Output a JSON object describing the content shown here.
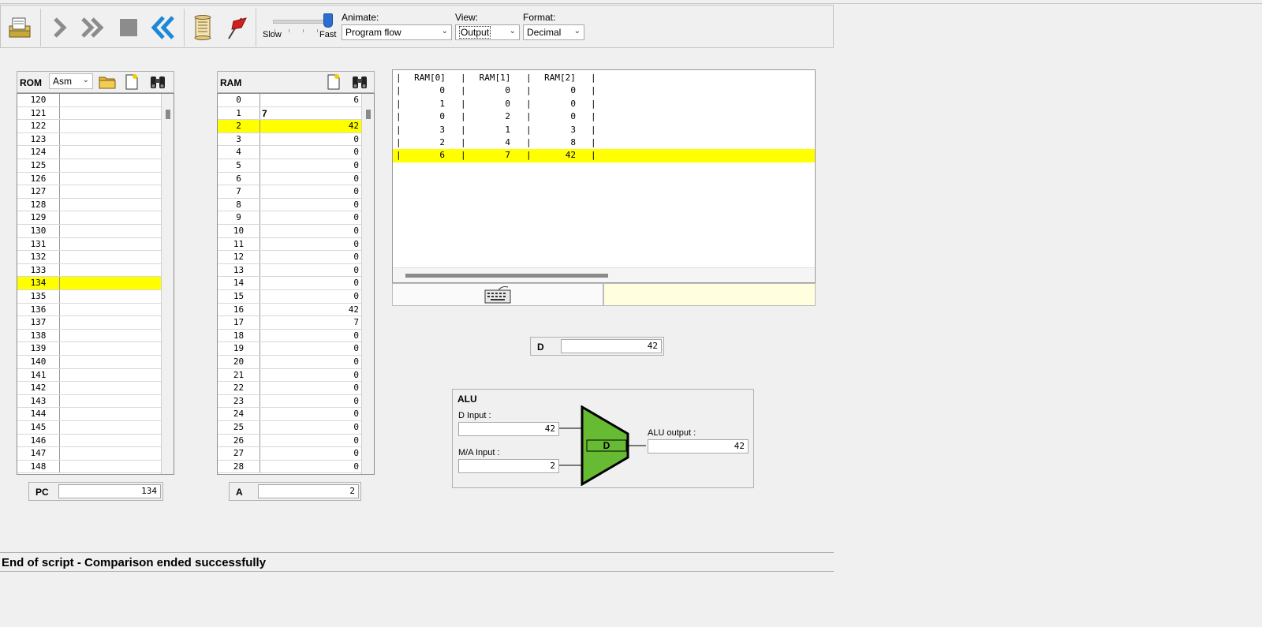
{
  "toolbar": {
    "speed": {
      "slow_label": "Slow",
      "fast_label": "Fast",
      "value": 1.0
    },
    "animate": {
      "label": "Animate:",
      "selected": "Program flow"
    },
    "view": {
      "label": "View:",
      "selected": "Output"
    },
    "format": {
      "label": "Format:",
      "selected": "Decimal"
    },
    "buttons": [
      "load-program-icon",
      "single-step-icon",
      "run-icon",
      "stop-icon",
      "reset-icon",
      "script-icon",
      "breakpoints-icon"
    ]
  },
  "rom": {
    "title": "ROM",
    "mode": "Asm",
    "highlight_row": 14,
    "rows": [
      {
        "idx": "120",
        "val": ""
      },
      {
        "idx": "121",
        "val": ""
      },
      {
        "idx": "122",
        "val": ""
      },
      {
        "idx": "123",
        "val": ""
      },
      {
        "idx": "124",
        "val": ""
      },
      {
        "idx": "125",
        "val": ""
      },
      {
        "idx": "126",
        "val": ""
      },
      {
        "idx": "127",
        "val": ""
      },
      {
        "idx": "128",
        "val": ""
      },
      {
        "idx": "129",
        "val": ""
      },
      {
        "idx": "130",
        "val": ""
      },
      {
        "idx": "131",
        "val": ""
      },
      {
        "idx": "132",
        "val": ""
      },
      {
        "idx": "133",
        "val": ""
      },
      {
        "idx": "134",
        "val": ""
      },
      {
        "idx": "135",
        "val": ""
      },
      {
        "idx": "136",
        "val": ""
      },
      {
        "idx": "137",
        "val": ""
      },
      {
        "idx": "138",
        "val": ""
      },
      {
        "idx": "139",
        "val": ""
      },
      {
        "idx": "140",
        "val": ""
      },
      {
        "idx": "141",
        "val": ""
      },
      {
        "idx": "142",
        "val": ""
      },
      {
        "idx": "143",
        "val": ""
      },
      {
        "idx": "144",
        "val": ""
      },
      {
        "idx": "145",
        "val": ""
      },
      {
        "idx": "146",
        "val": ""
      },
      {
        "idx": "147",
        "val": ""
      },
      {
        "idx": "148",
        "val": ""
      }
    ]
  },
  "pc": {
    "label": "PC",
    "value": "134"
  },
  "ram": {
    "title": "RAM",
    "highlight_row": 2,
    "editing_row": 1,
    "rows": [
      {
        "idx": "0",
        "val": "6"
      },
      {
        "idx": "1",
        "val": "7"
      },
      {
        "idx": "2",
        "val": "42"
      },
      {
        "idx": "3",
        "val": "0"
      },
      {
        "idx": "4",
        "val": "0"
      },
      {
        "idx": "5",
        "val": "0"
      },
      {
        "idx": "6",
        "val": "0"
      },
      {
        "idx": "7",
        "val": "0"
      },
      {
        "idx": "8",
        "val": "0"
      },
      {
        "idx": "9",
        "val": "0"
      },
      {
        "idx": "10",
        "val": "0"
      },
      {
        "idx": "11",
        "val": "0"
      },
      {
        "idx": "12",
        "val": "0"
      },
      {
        "idx": "13",
        "val": "0"
      },
      {
        "idx": "14",
        "val": "0"
      },
      {
        "idx": "15",
        "val": "0"
      },
      {
        "idx": "16",
        "val": "42"
      },
      {
        "idx": "17",
        "val": "7"
      },
      {
        "idx": "18",
        "val": "0"
      },
      {
        "idx": "19",
        "val": "0"
      },
      {
        "idx": "20",
        "val": "0"
      },
      {
        "idx": "21",
        "val": "0"
      },
      {
        "idx": "22",
        "val": "0"
      },
      {
        "idx": "23",
        "val": "0"
      },
      {
        "idx": "24",
        "val": "0"
      },
      {
        "idx": "25",
        "val": "0"
      },
      {
        "idx": "26",
        "val": "0"
      },
      {
        "idx": "27",
        "val": "0"
      },
      {
        "idx": "28",
        "val": "0"
      }
    ]
  },
  "a_reg": {
    "label": "A",
    "value": "2"
  },
  "output": {
    "headers": [
      "RAM[0]",
      "RAM[1]",
      "RAM[2]"
    ],
    "highlight_row": 5,
    "rows": [
      [
        "0",
        "0",
        "0"
      ],
      [
        "1",
        "0",
        "0"
      ],
      [
        "0",
        "2",
        "0"
      ],
      [
        "3",
        "1",
        "3"
      ],
      [
        "2",
        "4",
        "8"
      ],
      [
        "6",
        "7",
        "42"
      ]
    ]
  },
  "d_reg": {
    "label": "D",
    "value": "42"
  },
  "alu": {
    "title": "ALU",
    "d_input_label": "D Input :",
    "d_input_value": "42",
    "ma_input_label": "M/A Input :",
    "ma_input_value": "2",
    "op_label": "D",
    "output_label": "ALU output :",
    "output_value": "42"
  },
  "status": {
    "message": "End of script - Comparison ended successfully"
  },
  "colors": {
    "highlight": "#ffff00",
    "alu_green": "#66bb33",
    "slider_thumb": "#2b6fd0",
    "arrow_grey": "#8c8c8c",
    "reset_blue": "#1e88d8"
  }
}
